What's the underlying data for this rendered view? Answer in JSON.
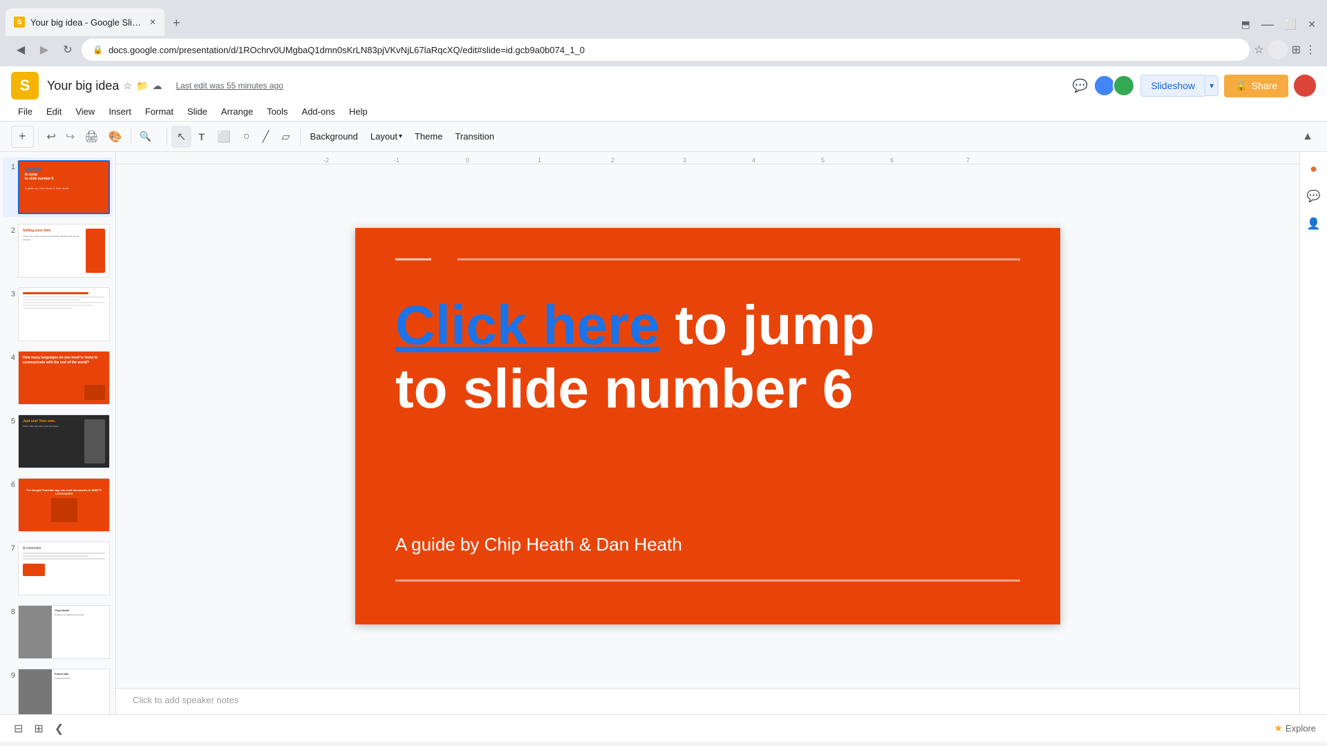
{
  "browser": {
    "tab_title": "Your big idea - Google Slides",
    "url": "docs.google.com/presentation/d/1ROchrv0UMgbaQ1dmn0sKrLN83pjVKvNjL67laRqcXQ/edit#slide=id.gcb9a0b074_1_0",
    "new_tab_label": "+"
  },
  "app": {
    "title": "Your big idea",
    "last_edit": "Last edit was 55 minutes ago",
    "logo_letter": "S"
  },
  "menu": {
    "items": [
      "File",
      "Edit",
      "View",
      "Insert",
      "Format",
      "Slide",
      "Arrange",
      "Tools",
      "Add-ons",
      "Help"
    ]
  },
  "toolbar": {
    "background_label": "Background",
    "layout_label": "Layout",
    "theme_label": "Theme",
    "transition_label": "Transition"
  },
  "header_buttons": {
    "slideshow_label": "Slideshow",
    "share_label": "Share"
  },
  "slide": {
    "click_here_text": "Click here",
    "to_jump_text": " to jump",
    "second_line": "to slide number 6",
    "subtitle": "A guide by Chip Heath & Dan Heath"
  },
  "slides_panel": {
    "slide_numbers": [
      "1",
      "2",
      "3",
      "4",
      "5",
      "6",
      "7",
      "8",
      "9"
    ]
  },
  "bottom": {
    "speaker_notes_placeholder": "Click to add speaker notes",
    "explore_label": "Explore"
  },
  "right_panel": {
    "add_icon": "+",
    "collapse_icon": "❮"
  }
}
